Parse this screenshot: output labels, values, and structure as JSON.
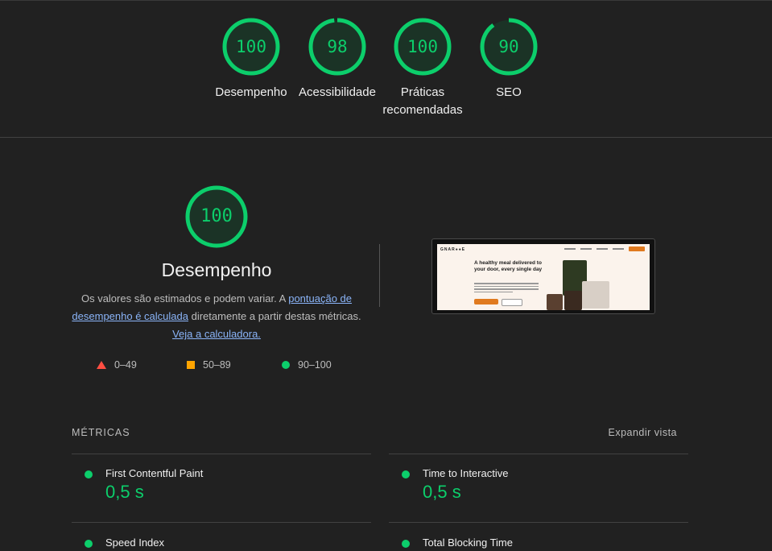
{
  "colors": {
    "pass": "#0cce6b",
    "average": "#ffa400",
    "fail": "#ff4e42",
    "link": "#8ab4f8"
  },
  "scores": [
    {
      "value": "100",
      "label": "Desempenho",
      "fraction": 1.0
    },
    {
      "value": "98",
      "label": "Acessibilidade",
      "fraction": 0.98
    },
    {
      "value": "100",
      "label": "Práticas recomendadas",
      "fraction": 1.0
    },
    {
      "value": "90",
      "label": "SEO",
      "fraction": 0.9
    }
  ],
  "performance": {
    "score": "100",
    "fraction": 1.0,
    "title": "Desempenho",
    "desc_part1": "Os valores são estimados e podem variar. A ",
    "desc_link1": "pontuação de desempenho é calculada",
    "desc_part2": " diretamente a partir destas métricas. ",
    "desc_link2": "Veja a calculadora."
  },
  "legend": {
    "fail": "0–49",
    "average": "50–89",
    "pass": "90–100"
  },
  "screenshot": {
    "logo": "GNAR●●E",
    "headline": "A healthy meal delivered to your door, every single day"
  },
  "metrics": {
    "heading": "MÉTRICAS",
    "expand_label": "Expandir vista",
    "items": [
      {
        "name": "First Contentful Paint",
        "value": "0,5 s"
      },
      {
        "name": "Time to Interactive",
        "value": "0,5 s"
      },
      {
        "name": "Speed Index",
        "value": ""
      },
      {
        "name": "Total Blocking Time",
        "value": ""
      }
    ]
  }
}
